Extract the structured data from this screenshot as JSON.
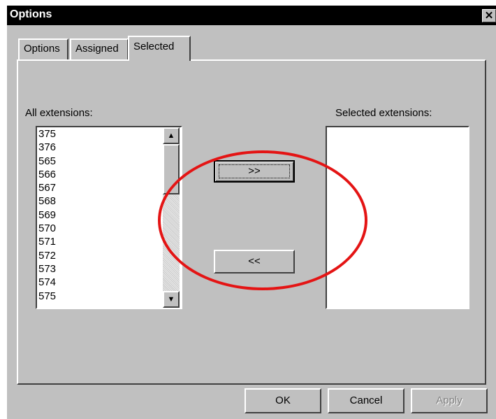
{
  "window": {
    "title": "Options",
    "close_glyph": "✕"
  },
  "tabs": [
    {
      "label": "Options"
    },
    {
      "label": "Assigned"
    },
    {
      "label": "Selected"
    }
  ],
  "panel": {
    "all_label": "All extensions:",
    "selected_label": "Selected extensions:",
    "all_extensions": [
      "375",
      "376",
      "565",
      "566",
      "567",
      "568",
      "569",
      "570",
      "571",
      "572",
      "573",
      "574",
      "575"
    ],
    "selected_extensions": [],
    "add_label": ">>",
    "remove_label": "<<"
  },
  "footer": {
    "ok_label": "OK",
    "cancel_label": "Cancel",
    "apply_label": "Apply"
  },
  "colors": {
    "annotation": "#e41414",
    "face": "#c0c0c0"
  },
  "scroll_position": 0
}
